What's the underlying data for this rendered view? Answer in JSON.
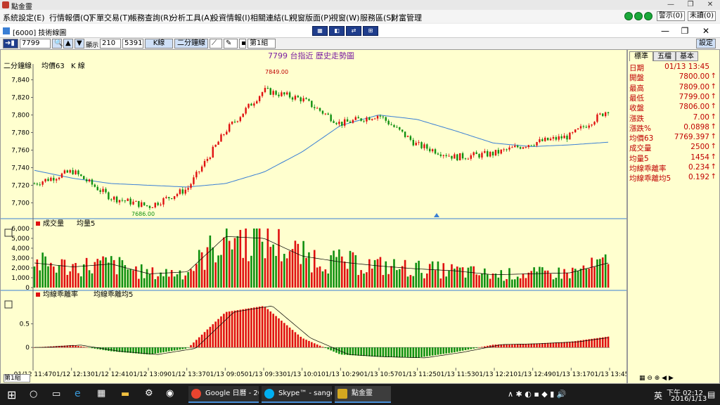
{
  "window": {
    "title": "點金靈",
    "minimize": "—",
    "maximize": "❐",
    "close": "✕"
  },
  "menu": [
    "系統設定(E)",
    "行情報價(Q)",
    "下單交易(T)",
    "帳務查詢(R)",
    "分析工具(A)",
    "投資情報(I)",
    "相關連結(L)",
    "視窗版面(P)",
    "視窗(W)",
    "服務區(S)",
    "財富管理"
  ],
  "top_buttons": {
    "alert": "警示(0)",
    "unread": "未讀(0)"
  },
  "subwindow": {
    "title": "[6000] 技術線圖",
    "minimize": "—",
    "restore": "❐",
    "close": "✕"
  },
  "toolbar": {
    "symbol": "7799",
    "display_label": "顯示",
    "display_count": "210",
    "total_count": "5391",
    "kline": "K線",
    "period": "二分鐘線",
    "group": "第1組",
    "settings": "設定"
  },
  "chart": {
    "title": "7799  台指近    歷史走勢圖",
    "price_legend": {
      "period": "二分鐘線",
      "avg": "均價63",
      "kline": "K 線"
    },
    "price_max_label": "7849.00",
    "price_min_label": "7686.00",
    "volume_legend": {
      "a": "成交量",
      "b": "均量5"
    },
    "deviation_legend": {
      "a": "均線乖離率",
      "b": "均線乖離均5"
    },
    "price_ticks": [
      "7,840",
      "7,820",
      "7,800",
      "7,780",
      "7,760",
      "7,740",
      "7,720",
      "7,700"
    ],
    "volume_ticks": [
      "6,000",
      "5,000",
      "4,000",
      "3,000",
      "2,000",
      "1,000",
      "0"
    ],
    "deviation_ticks": [
      "0.5",
      "0"
    ],
    "time_ticks": [
      "01/12 11:47",
      "01/12 12:13",
      "01/12 12:41",
      "01/12 13:09",
      "01/12 13:37",
      "01/13 09:05",
      "01/13 09:33",
      "01/13 10:01",
      "01/13 10:29",
      "01/13 10:57",
      "01/13 11:25",
      "01/13 11:53",
      "01/13 12:21",
      "01/13 12:49",
      "01/13 13:17",
      "01/13 13:45"
    ],
    "bottom_group": "第1組",
    "colors": {
      "up": "#e01010",
      "down": "#109010",
      "avg": "#3a7fd5",
      "bg": "#ffffcf"
    }
  },
  "chart_data": {
    "type": "line",
    "title": "7799  台指近    歷史走勢圖",
    "series": [
      {
        "name": "均價63",
        "x": [
          "01/12 11:47",
          "01/12 12:13",
          "01/12 12:41",
          "01/12 13:09",
          "01/12 13:37",
          "01/13 09:05",
          "01/13 09:33",
          "01/13 10:01",
          "01/13 10:29",
          "01/13 10:57",
          "01/13 11:25",
          "01/13 11:53",
          "01/13 12:21",
          "01/13 12:49",
          "01/13 13:17",
          "01/13 13:45"
        ],
        "values": [
          7737,
          7728,
          7722,
          7720,
          7718,
          7722,
          7735,
          7758,
          7788,
          7800,
          7795,
          7782,
          7768,
          7764,
          7766,
          7769
        ]
      },
      {
        "name": "K 線",
        "x": [
          "01/12 11:47",
          "01/12 12:13",
          "01/12 12:41",
          "01/12 13:09",
          "01/12 13:37",
          "01/13 09:05",
          "01/13 09:33",
          "01/13 10:01",
          "01/13 10:29",
          "01/13 10:57",
          "01/13 11:25",
          "01/13 11:53",
          "01/13 12:21",
          "01/13 12:49",
          "01/13 13:17",
          "01/13 13:45"
        ],
        "values": [
          7722,
          7736,
          7706,
          7696,
          7716,
          7782,
          7828,
          7818,
          7790,
          7800,
          7766,
          7752,
          7756,
          7768,
          7776,
          7806
        ]
      }
    ],
    "ylim": [
      7690,
      7850
    ],
    "volume": [
      2500,
      2100,
      2400,
      1400,
      1600,
      5200,
      5000,
      3200,
      2600,
      2200,
      1900,
      1700,
      1300,
      1400,
      1500,
      2500
    ],
    "deviation": [
      0,
      0.05,
      -0.08,
      -0.15,
      -0.02,
      0.75,
      0.88,
      0.2,
      -0.15,
      -0.2,
      -0.22,
      -0.1,
      0.06,
      0.08,
      0.12,
      0.23
    ]
  },
  "info_tabs": [
    "標準",
    "五檔",
    "基本"
  ],
  "info": [
    {
      "label": "日期",
      "value": "01/13 13:45",
      "arrow": ""
    },
    {
      "label": "開盤",
      "value": "7800.00",
      "arrow": "↑"
    },
    {
      "label": "最高",
      "value": "7809.00",
      "arrow": "↑"
    },
    {
      "label": "最低",
      "value": "7799.00",
      "arrow": "↑"
    },
    {
      "label": "收盤",
      "value": "7806.00",
      "arrow": "↑"
    },
    {
      "label": "漲跌",
      "value": "7.00",
      "arrow": "↑"
    },
    {
      "label": "漲跌%",
      "value": "0.0898",
      "arrow": "↑"
    },
    {
      "label": "均價63",
      "value": "7769.397",
      "arrow": "↑"
    },
    {
      "label": "成交量",
      "value": "2500",
      "arrow": "↑"
    },
    {
      "label": "均量5",
      "value": "1454",
      "arrow": "↑"
    },
    {
      "label": "均線乖離率",
      "value": "0.234",
      "arrow": "↑"
    },
    {
      "label": "均線乖離均5",
      "value": "0.192",
      "arrow": "↑"
    }
  ],
  "taskbar": {
    "apps": [
      "Google 日曆 - 201...",
      "Skype™ - sangola...",
      "點金靈"
    ],
    "ime": "英",
    "time": "下午 02:12",
    "date": "2016/1/13"
  }
}
